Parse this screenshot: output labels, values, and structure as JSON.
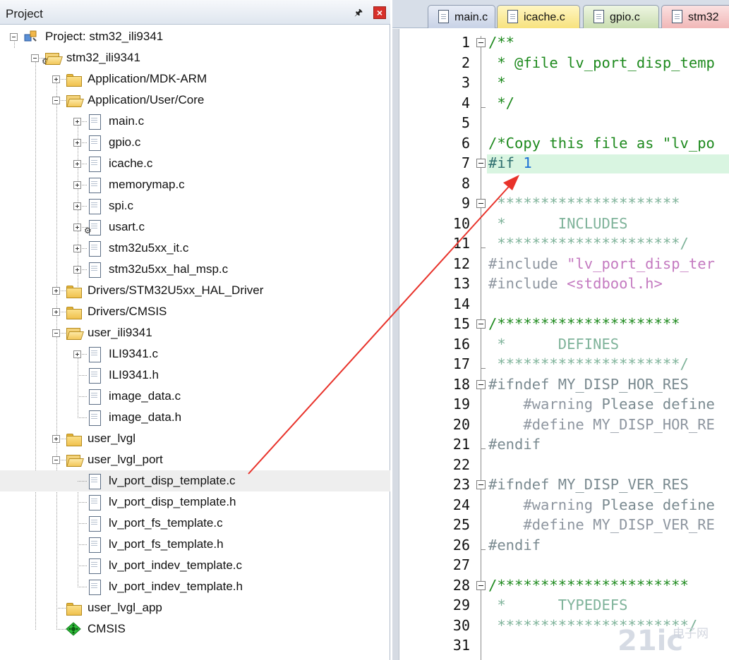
{
  "project_panel": {
    "title": "Project",
    "tree": [
      {
        "label": "Project: stm32_ili9341",
        "icon": "project-icon"
      },
      {
        "label": "stm32_ili9341",
        "icon": "target-folder-icon"
      },
      {
        "label": "Application/MDK-ARM",
        "icon": "folder-icon"
      },
      {
        "label": "Application/User/Core",
        "icon": "folder-open-icon"
      },
      {
        "label": "main.c",
        "icon": "file-icon"
      },
      {
        "label": "gpio.c",
        "icon": "file-icon"
      },
      {
        "label": "icache.c",
        "icon": "file-icon"
      },
      {
        "label": "memorymap.c",
        "icon": "file-icon"
      },
      {
        "label": "spi.c",
        "icon": "file-icon"
      },
      {
        "label": "usart.c",
        "icon": "file-icon"
      },
      {
        "label": "stm32u5xx_it.c",
        "icon": "file-icon"
      },
      {
        "label": "stm32u5xx_hal_msp.c",
        "icon": "file-icon"
      },
      {
        "label": "Drivers/STM32U5xx_HAL_Driver",
        "icon": "folder-icon"
      },
      {
        "label": "Drivers/CMSIS",
        "icon": "folder-icon"
      },
      {
        "label": "user_ili9341",
        "icon": "folder-open-icon"
      },
      {
        "label": "ILI9341.c",
        "icon": "file-icon"
      },
      {
        "label": "ILI9341.h",
        "icon": "file-icon"
      },
      {
        "label": "image_data.c",
        "icon": "file-icon"
      },
      {
        "label": "image_data.h",
        "icon": "file-icon"
      },
      {
        "label": "user_lvgl",
        "icon": "folder-icon"
      },
      {
        "label": "user_lvgl_port",
        "icon": "folder-open-icon"
      },
      {
        "label": "lv_port_disp_template.c",
        "icon": "file-icon"
      },
      {
        "label": "lv_port_disp_template.h",
        "icon": "file-icon"
      },
      {
        "label": "lv_port_fs_template.c",
        "icon": "file-icon"
      },
      {
        "label": "lv_port_fs_template.h",
        "icon": "file-icon"
      },
      {
        "label": "lv_port_indev_template.c",
        "icon": "file-icon"
      },
      {
        "label": "lv_port_indev_template.h",
        "icon": "file-icon"
      },
      {
        "label": "user_lvgl_app",
        "icon": "folder-icon"
      },
      {
        "label": "CMSIS",
        "icon": "cmsis-icon"
      }
    ]
  },
  "editor": {
    "tabs": [
      {
        "label": "main.c",
        "color": "#c8d2e6"
      },
      {
        "label": "icache.c",
        "color": "#f7e27e"
      },
      {
        "label": "gpio.c",
        "color": "#c9ddb0"
      },
      {
        "label": "stm32",
        "color": "#f1b7b7"
      }
    ],
    "highlight_color": "#d9f5e1",
    "lines": [
      {
        "n": "1",
        "text": "/**"
      },
      {
        "n": "2",
        "text": " * @file lv_port_disp_temp"
      },
      {
        "n": "3",
        "text": " *"
      },
      {
        "n": "4",
        "text": " */"
      },
      {
        "n": "5",
        "text": ""
      },
      {
        "n": "6",
        "text": "/*Copy this file as \"lv_po"
      },
      {
        "n": "7",
        "text": "#if 1"
      },
      {
        "n": "8",
        "text": ""
      },
      {
        "n": "9",
        "text": " *********************"
      },
      {
        "n": "10",
        "text": " *      INCLUDES"
      },
      {
        "n": "11",
        "text": " *********************/"
      },
      {
        "n": "12",
        "text": "#include \"lv_port_disp_ter"
      },
      {
        "n": "13",
        "text": "#include <stdbool.h>"
      },
      {
        "n": "14",
        "text": ""
      },
      {
        "n": "15",
        "text": "/*********************"
      },
      {
        "n": "16",
        "text": " *      DEFINES"
      },
      {
        "n": "17",
        "text": " *********************/"
      },
      {
        "n": "18",
        "text": "#ifndef MY_DISP_HOR_RES"
      },
      {
        "n": "19",
        "text": "    #warning Please define"
      },
      {
        "n": "20",
        "text": "    #define MY_DISP_HOR_RE"
      },
      {
        "n": "21",
        "text": "#endif"
      },
      {
        "n": "22",
        "text": ""
      },
      {
        "n": "23",
        "text": "#ifndef MY_DISP_VER_RES"
      },
      {
        "n": "24",
        "text": "    #warning Please define"
      },
      {
        "n": "25",
        "text": "    #define MY_DISP_VER_RE"
      },
      {
        "n": "26",
        "text": "#endif"
      },
      {
        "n": "27",
        "text": ""
      },
      {
        "n": "28",
        "text": "/**********************"
      },
      {
        "n": "29",
        "text": " *      TYPEDEFS"
      },
      {
        "n": "30",
        "text": " **********************/"
      },
      {
        "n": "31",
        "text": ""
      }
    ]
  },
  "annotation": {
    "arrow_color": "#e8322a"
  },
  "watermark": {
    "big": "21ic",
    "small": "电子网"
  }
}
